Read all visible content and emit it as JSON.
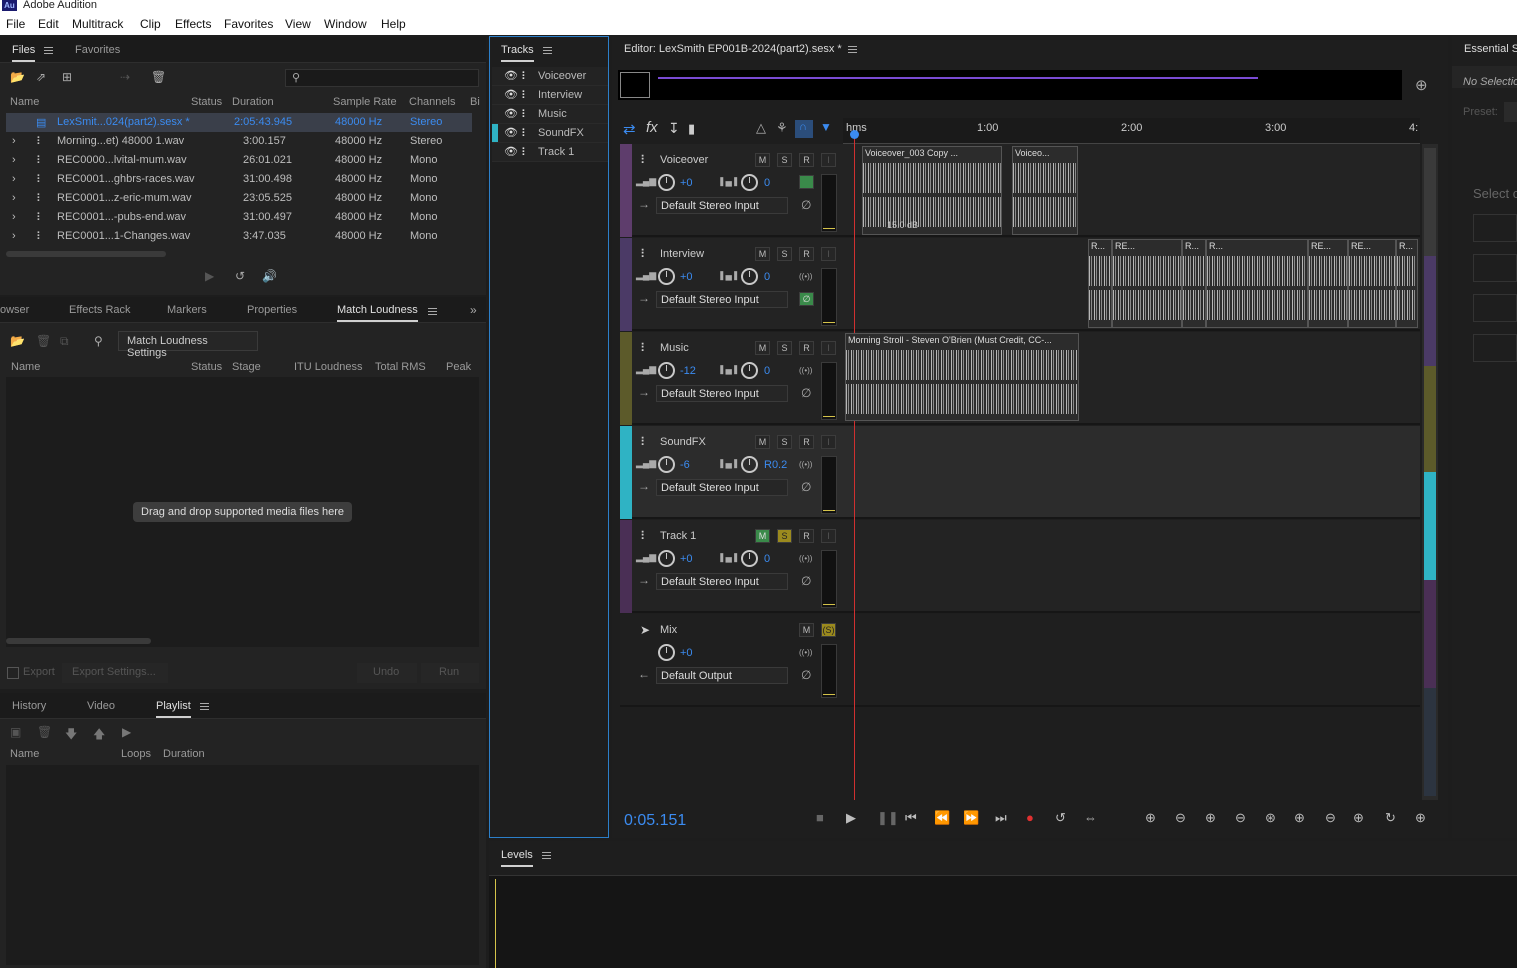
{
  "app": {
    "title": "Adobe Audition",
    "logo": "Au"
  },
  "menu": [
    "File",
    "Edit",
    "Multitrack",
    "Clip",
    "Effects",
    "Favorites",
    "View",
    "Window",
    "Help"
  ],
  "files_panel": {
    "tabs": [
      "Files",
      "Favorites"
    ],
    "columns": [
      "Name",
      "Status",
      "Duration",
      "Sample Rate",
      "Channels",
      "Bi"
    ],
    "rows": [
      {
        "name": "LexSmit...024(part2).sesx *",
        "duration": "2:05:43.945",
        "rate": "48000 Hz",
        "channels": "Stereo"
      },
      {
        "name": "Morning...et) 48000 1.wav",
        "duration": "3:00.157",
        "rate": "48000 Hz",
        "channels": "Stereo"
      },
      {
        "name": "REC0000...lvital-mum.wav",
        "duration": "26:01.021",
        "rate": "48000 Hz",
        "channels": "Mono"
      },
      {
        "name": "REC0001...ghbrs-races.wav",
        "duration": "31:00.498",
        "rate": "48000 Hz",
        "channels": "Mono"
      },
      {
        "name": "REC0001...z-eric-mum.wav",
        "duration": "23:05.525",
        "rate": "48000 Hz",
        "channels": "Mono"
      },
      {
        "name": "REC0001...-pubs-end.wav",
        "duration": "31:00.497",
        "rate": "48000 Hz",
        "channels": "Mono"
      },
      {
        "name": "REC0001...1-Changes.wav",
        "duration": "3:47.035",
        "rate": "48000 Hz",
        "channels": "Mono"
      }
    ]
  },
  "match_panel": {
    "tabs": [
      "owser",
      "Effects Rack",
      "Markers",
      "Properties",
      "Match Loudness"
    ],
    "settings_btn": "Match Loudness Settings",
    "columns": [
      "Name",
      "Status",
      "Stage",
      "ITU Loudness",
      "Total RMS",
      "Peak"
    ],
    "drop_text": "Drag and drop supported media files here",
    "export": "Export",
    "export_settings": "Export Settings...",
    "undo": "Undo",
    "run": "Run"
  },
  "playlist_panel": {
    "tabs": [
      "History",
      "Video",
      "Playlist"
    ],
    "columns": [
      "Name",
      "Loops",
      "Duration"
    ]
  },
  "tracks_panel": {
    "title": "Tracks",
    "items": [
      "Voiceover",
      "Interview",
      "Music",
      "SoundFX",
      "Track 1"
    ]
  },
  "editor": {
    "title": "Editor: LexSmith EP001B-2024(part2).sesx *",
    "ruler": [
      "hms",
      "1:00",
      "2:00",
      "3:00",
      "4:"
    ],
    "tracks": [
      {
        "name": "Voiceover",
        "vol": "+0",
        "pan": "0",
        "input": "Default Stereo Input",
        "color": "#5e3d6c"
      },
      {
        "name": "Interview",
        "vol": "+0",
        "pan": "0",
        "input": "Default Stereo Input",
        "color": "#4b3a66"
      },
      {
        "name": "Music",
        "vol": "-12",
        "pan": "0",
        "input": "Default Stereo Input",
        "color": "#5c5a2a"
      },
      {
        "name": "SoundFX",
        "vol": "-6",
        "pan": "R0.2",
        "input": "Default Stereo Input",
        "color": "#2fb3c4"
      },
      {
        "name": "Track 1",
        "vol": "+0",
        "pan": "0",
        "input": "Default Stereo Input",
        "color": "#4a2f55"
      }
    ],
    "mix": {
      "name": "Mix",
      "vol": "+0",
      "output": "Default Output"
    },
    "clips": {
      "vo1": "Voiceover_003 Copy ...",
      "vo2": "Voiceo...",
      "vo_db": "15.0 dB",
      "music": "Morning Stroll - Steven O'Brien (Must Credit, CC-...",
      "int": [
        "R...",
        "RE...",
        "R...",
        "R...",
        "RE...",
        "RE...",
        "R..."
      ]
    },
    "btn_m": "M",
    "btn_s": "S",
    "btn_r": "R",
    "btn_i": "I",
    "time": "0:05.151"
  },
  "right_panel": {
    "title": "Essential Se",
    "sub": "No Selection",
    "preset": "Preset:",
    "select": "Select c"
  },
  "levels": {
    "title": "Levels"
  }
}
